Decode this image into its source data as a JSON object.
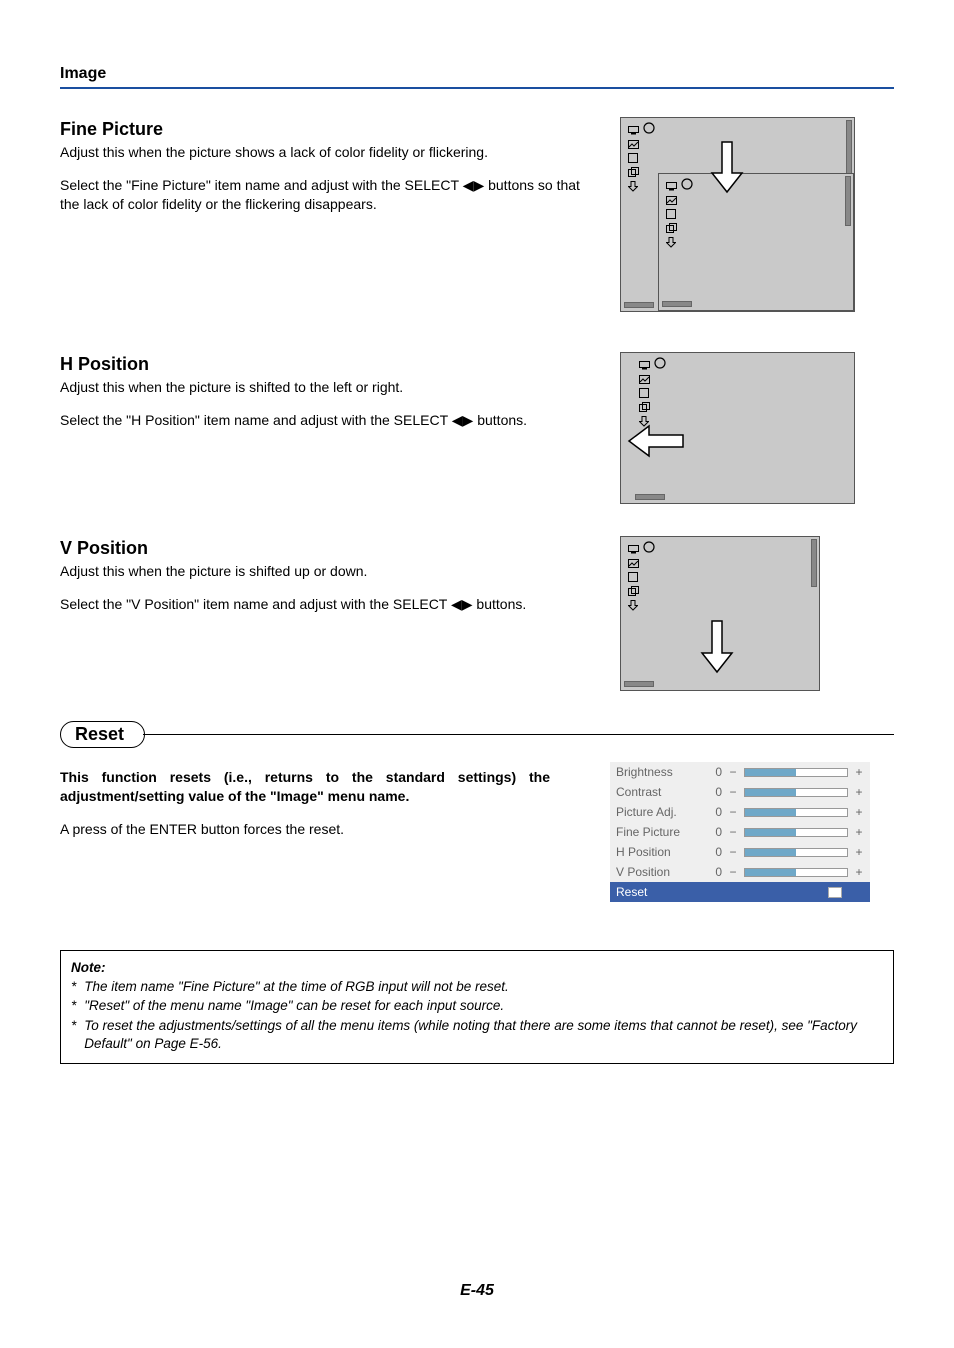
{
  "header": {
    "section": "Image"
  },
  "sections": {
    "fine_picture": {
      "title": "Fine Picture",
      "desc": "Adjust this when the picture shows a lack of color fidelity or flickering.",
      "instr_pre": "Select the \"Fine Picture\" item name and adjust with the SELECT ",
      "instr_post": " buttons so that the lack of color fidelity or the flickering disappears."
    },
    "h_position": {
      "title": "H Position",
      "desc": "Adjust this when the picture is shifted to the left or right.",
      "instr_pre": "Select the \"H Position\" item name and adjust with the SELECT ",
      "instr_post": " buttons."
    },
    "v_position": {
      "title": "V Position",
      "desc": "Adjust this when the picture is shifted up or down.",
      "instr_pre": "Select the \"V Position\" item name and adjust with the SELECT ",
      "instr_post": " buttons."
    }
  },
  "reset": {
    "heading": "Reset",
    "bold_desc": "This function resets (i.e., returns to the standard settings) the adjustment/setting value of the \"Image\" menu name.",
    "instr": "A press of the ENTER button forces the reset."
  },
  "menu_items": [
    {
      "label": "Brightness",
      "value": "0",
      "selected": false
    },
    {
      "label": "Contrast",
      "value": "0",
      "selected": false
    },
    {
      "label": "Picture Adj.",
      "value": "0",
      "selected": false
    },
    {
      "label": "Fine Picture",
      "value": "0",
      "selected": false
    },
    {
      "label": "H Position",
      "value": "0",
      "selected": false
    },
    {
      "label": "V Position",
      "value": "0",
      "selected": false
    },
    {
      "label": "Reset",
      "value": "",
      "selected": true
    }
  ],
  "note": {
    "title": "Note:",
    "lines": [
      "The item name \"Fine Picture\" at the time of RGB input will not be reset.",
      "\"Reset\" of the menu name \"Image\" can be reset for each input source.",
      "To reset the adjustments/settings of all the menu items (while noting that there are some items that cannot be reset), see \"Factory Default\" on Page E-56."
    ]
  },
  "page_number": "E-45",
  "symbols": {
    "lr_arrows": "◀▶"
  }
}
